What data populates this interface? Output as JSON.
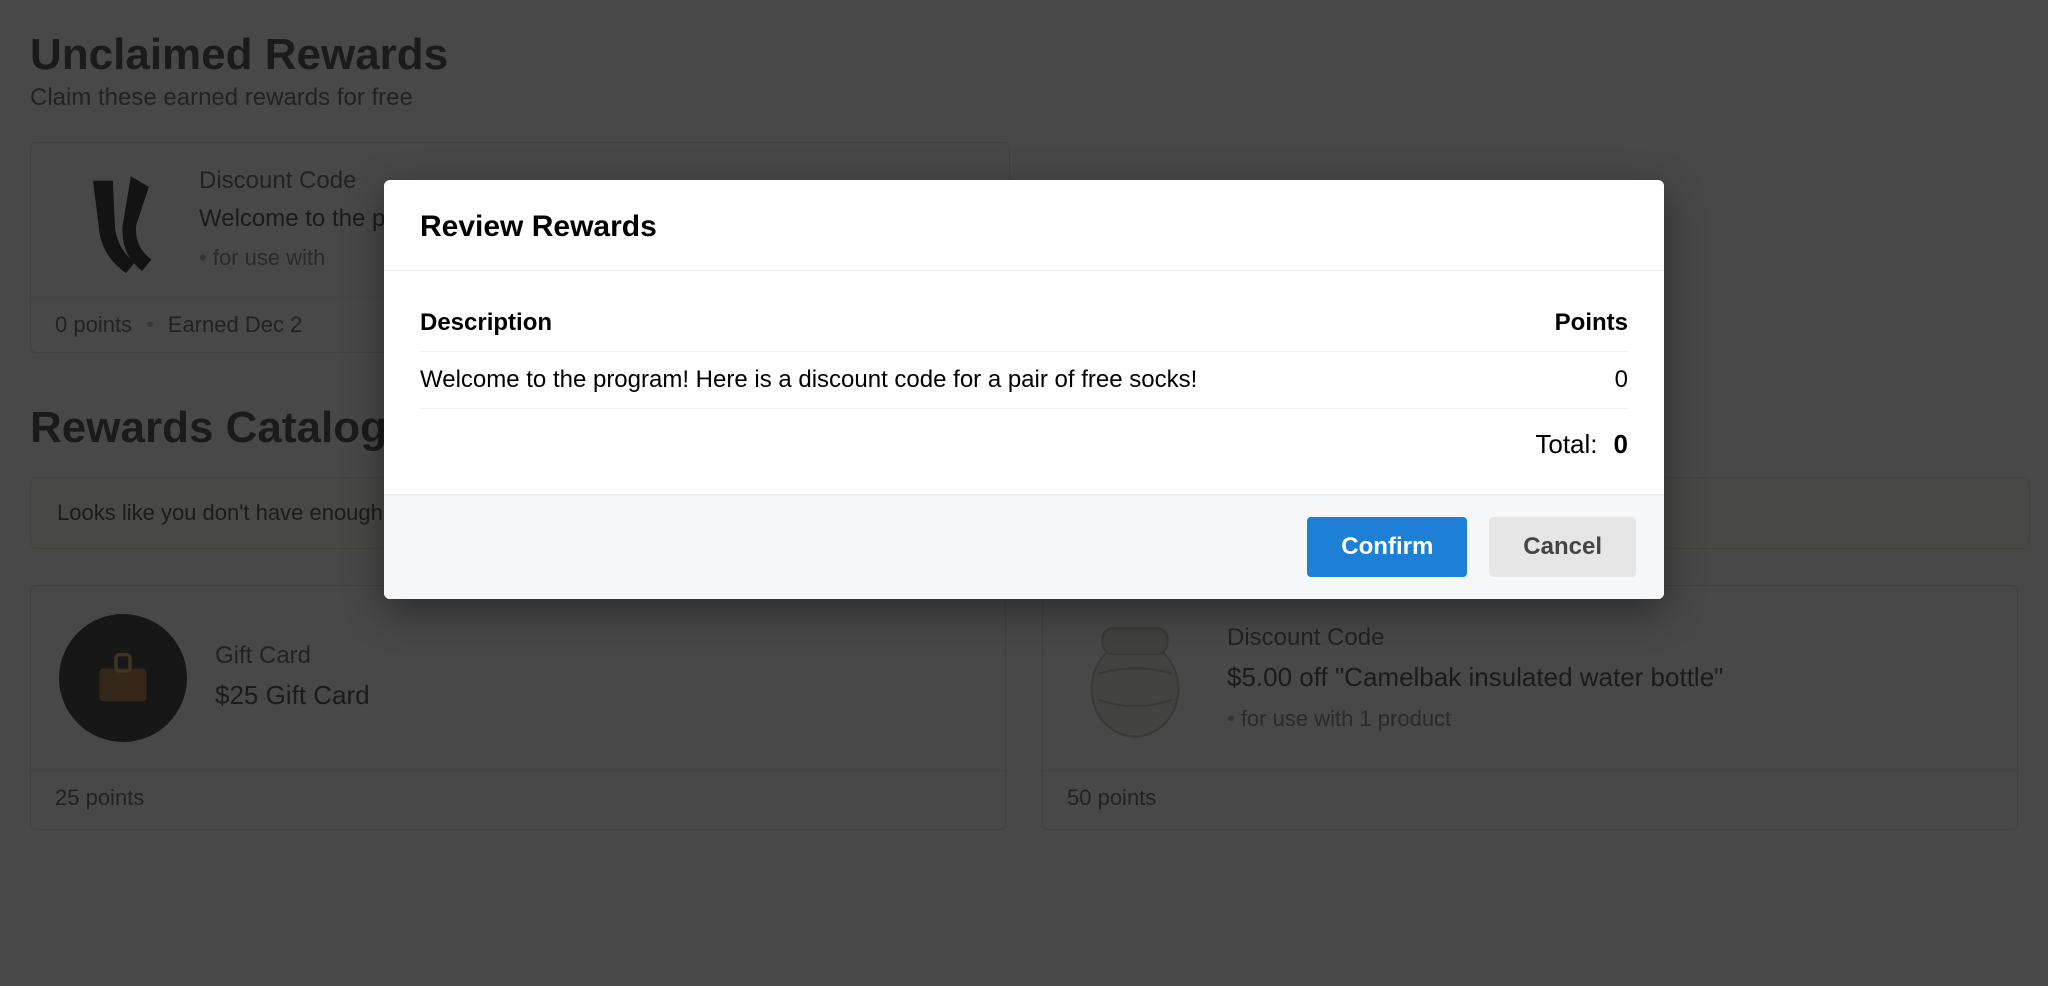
{
  "header": {
    "title": "Unclaimed Rewards",
    "subtitle": "Claim these earned rewards for free"
  },
  "unclaimed": {
    "type_label": "Discount Code",
    "title": "Welcome to the program! Here is a discount code for a pair of free socks!",
    "note": "for use with",
    "footer_points": "0 points",
    "footer_earned": "Earned Dec 2"
  },
  "catalog": {
    "title": "Rewards Catalog",
    "notice": "Looks like you don't have enough points.",
    "items": [
      {
        "type_label": "Gift Card",
        "title": "$25 Gift Card",
        "note": "",
        "footer_points": "25 points"
      },
      {
        "type_label": "Discount Code",
        "title": "$5.00 off \"Camelbak insulated water bottle\"",
        "note": "for use with 1 product",
        "footer_points": "50 points"
      }
    ]
  },
  "modal": {
    "title": "Review Rewards",
    "col_desc": "Description",
    "col_points": "Points",
    "row_desc": "Welcome to the program! Here is a discount code for a pair of free socks!",
    "row_points": "0",
    "total_label": "Total:",
    "total_value": "0",
    "confirm": "Confirm",
    "cancel": "Cancel"
  }
}
